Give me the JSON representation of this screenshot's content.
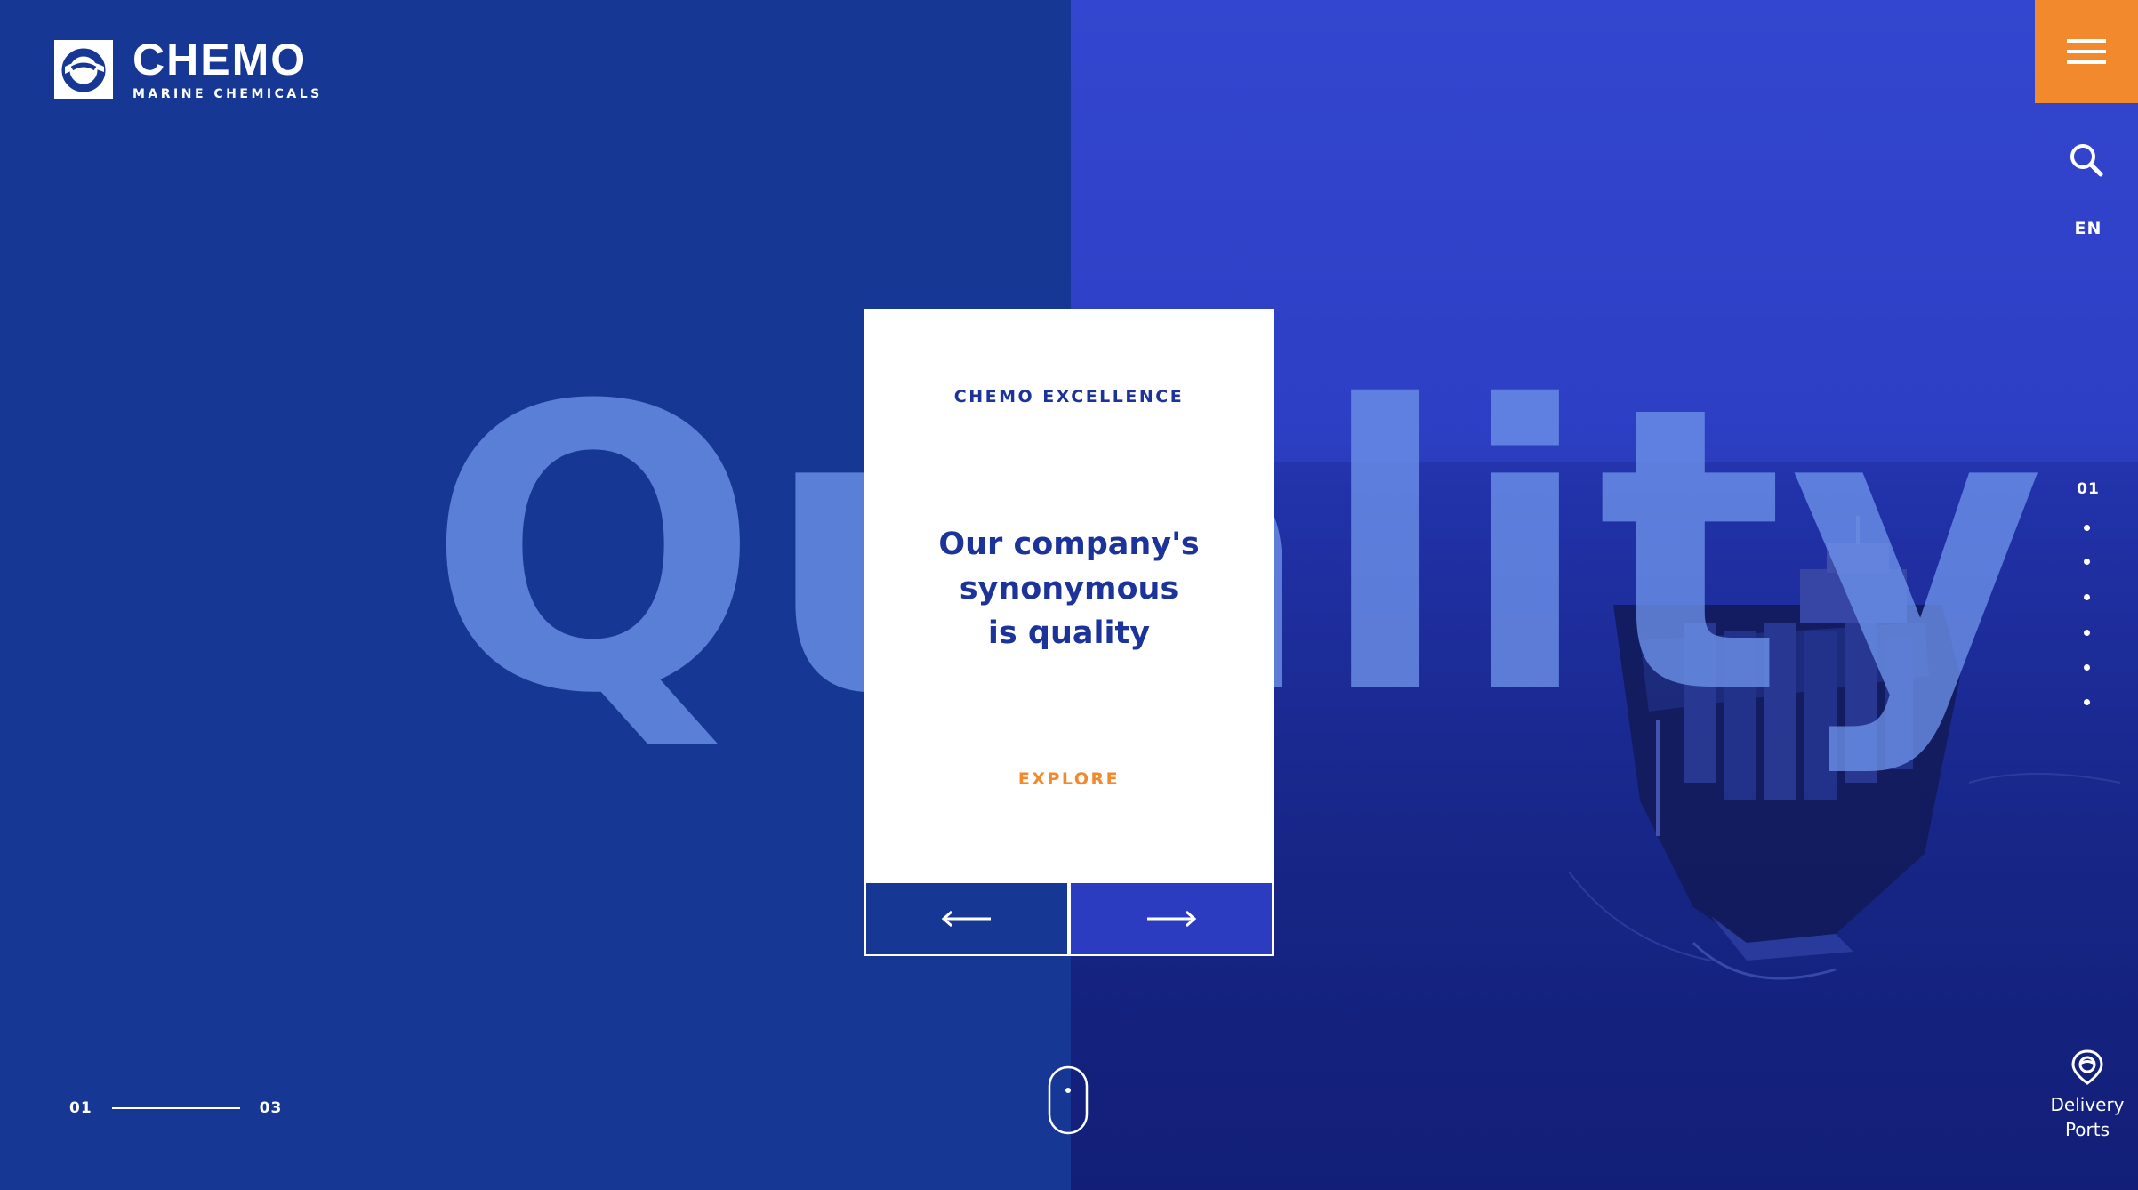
{
  "brand": {
    "name": "CHEMO",
    "tagline": "MARINE CHEMICALS"
  },
  "colors": {
    "left_panel": "#163894",
    "right_panel": "#2d3fc4",
    "accent": "#f2892c",
    "card_text": "#1c3399",
    "background_word": "#6e93ea"
  },
  "header": {
    "menu_icon": "hamburger-icon",
    "search_icon": "search-icon",
    "language": "EN"
  },
  "hero": {
    "background_word": "Quality",
    "card": {
      "kicker": "CHEMO EXCELLENCE",
      "headline_lines": [
        "Our company's",
        "synonymous",
        "is quality"
      ],
      "cta": "EXPLORE"
    },
    "nav": {
      "prev_icon": "arrow-left-icon",
      "next_icon": "arrow-right-icon"
    }
  },
  "pager": {
    "current": "01",
    "dot_count": 6
  },
  "slide_counter": {
    "current": "01",
    "total": "03"
  },
  "scroll_icon": "mouse-scroll-icon",
  "delivery_ports": {
    "icon": "map-pin-icon",
    "label_lines": [
      "Delivery",
      "Ports"
    ]
  }
}
